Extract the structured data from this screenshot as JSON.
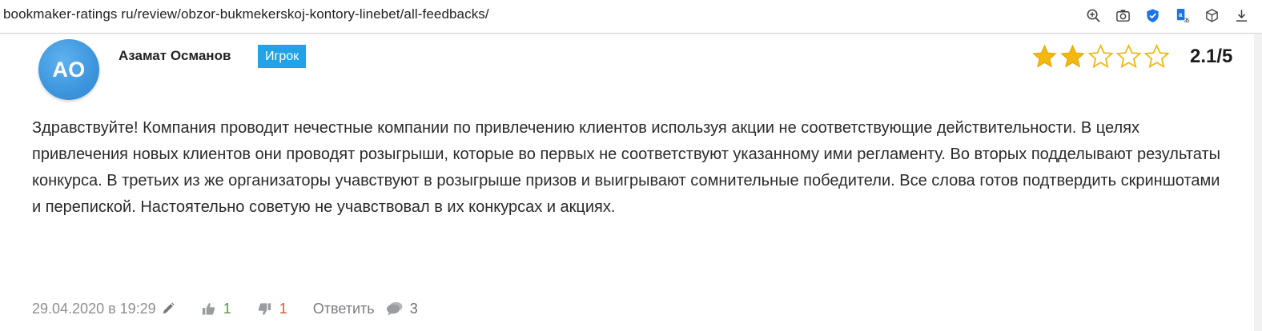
{
  "browser": {
    "url": "bookmaker-ratings ru/review/obzor-bukmekerskoj-kontory-linebet/all-feedbacks/",
    "toolbar_icons": [
      "zoom-icon",
      "camera-icon",
      "shield-icon",
      "translate-icon",
      "box-icon",
      "download-icon"
    ]
  },
  "review": {
    "avatar_initials": "АО",
    "author": "Азамат Османов",
    "role": "Игрок",
    "rating": {
      "filled": 2,
      "total": 5,
      "score_text": "2.1/5"
    },
    "text": "Здравствуйте! Компания проводит нечестные компании по привлечению клиентов используя акции не соответствующие действительности. В целях привлечения новых клиентов они проводят розыгрыши, которые во первых не соответствуют указанному ими регламенту. Во вторых подделывают результаты конкурса. В третьих из же организаторы учавствуют в розыгрыше призов и выигрывают сомнительные победители. Все слова готов подтвердить скриншотами и перепиской. Настоятельно советую не учавствовал в их конкурсах и акциях.",
    "date": "29.04.2020 в 19:29",
    "likes": "1",
    "dislikes": "1",
    "reply_label": "Ответить",
    "comments_count": "3"
  },
  "colors": {
    "badge": "#22a3e7",
    "star_filled": "#f5b80f",
    "star_empty": "#f5b80f",
    "like": "#4e9a3b",
    "dislike": "#e0552d"
  }
}
